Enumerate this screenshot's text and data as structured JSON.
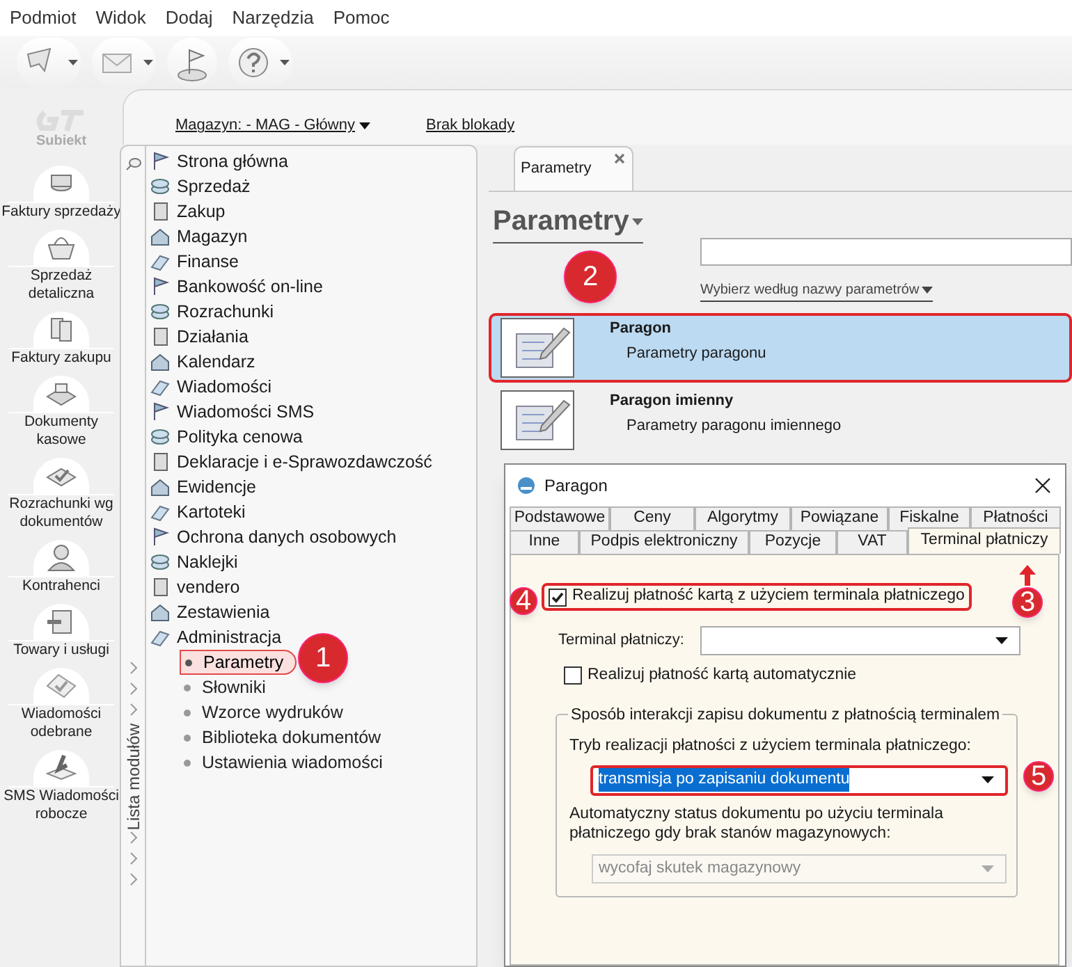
{
  "menu": [
    "Podmiot",
    "Widok",
    "Dodaj",
    "Narzędzia",
    "Pomoc"
  ],
  "app_logo": {
    "label": "Subiekt"
  },
  "nav": [
    {
      "label": "Faktury sprzedaży"
    },
    {
      "label": "Sprzedaż detaliczna"
    },
    {
      "label": "Faktury zakupu"
    },
    {
      "label": "Dokumenty kasowe"
    },
    {
      "label": "Rozrachunki wg dokumentów"
    },
    {
      "label": "Kontrahenci"
    },
    {
      "label": "Towary i usługi"
    },
    {
      "label": "Wiadomości odebrane"
    },
    {
      "label": "SMS Wiadomości robocze"
    }
  ],
  "top_bar": {
    "warehouse": "Magazyn: - MAG - Główny",
    "lock": "Brak blokady"
  },
  "module_list": {
    "title": "Lista modułów",
    "items": [
      {
        "label": "Strona główna",
        "selected": false
      },
      {
        "label": "Sprzedaż",
        "selected": false
      },
      {
        "label": "Zakup",
        "selected": false
      },
      {
        "label": "Magazyn",
        "selected": false
      },
      {
        "label": "Finanse",
        "selected": false
      },
      {
        "label": "Bankowość on-line",
        "selected": false
      },
      {
        "label": "Rozrachunki",
        "selected": false
      },
      {
        "label": "Działania",
        "selected": false
      },
      {
        "label": "Kalendarz",
        "selected": false
      },
      {
        "label": "Wiadomości",
        "selected": false
      },
      {
        "label": "Wiadomości SMS",
        "selected": false
      },
      {
        "label": "Polityka cenowa",
        "selected": false
      },
      {
        "label": "Deklaracje i e-Sprawozdawczość",
        "selected": false
      },
      {
        "label": "Ewidencje",
        "selected": false
      },
      {
        "label": "Kartoteki",
        "selected": false
      },
      {
        "label": "Ochrona danych osobowych",
        "selected": false
      },
      {
        "label": "Naklejki",
        "selected": false
      },
      {
        "label": "vendero",
        "selected": false
      },
      {
        "label": "Zestawienia",
        "selected": false
      },
      {
        "label": "Administracja",
        "selected": false,
        "children": [
          {
            "label": "Parametry",
            "selected": true,
            "highlighted": true
          },
          {
            "label": "Słowniki",
            "selected": false,
            "highlighted": false
          },
          {
            "label": "Wzorce wydruków",
            "selected": false,
            "highlighted": false
          },
          {
            "label": "Biblioteka dokumentów",
            "selected": false,
            "highlighted": false
          },
          {
            "label": "Ustawienia wiadomości",
            "selected": false,
            "highlighted": false
          }
        ]
      }
    ]
  },
  "tab": {
    "label": "Parametry"
  },
  "page_title": "Parametry",
  "filter_link": "Wybierz według nazwy parametrów",
  "params": [
    {
      "title": "Paragon",
      "subtitle": "Parametry paragonu",
      "selected": true,
      "highlighted": true
    },
    {
      "title": "Paragon imienny",
      "subtitle": "Parametry paragonu imiennego",
      "selected": false,
      "highlighted": false
    }
  ],
  "dialog": {
    "title": "Paragon",
    "tab_rows": [
      [
        {
          "label": "Podstawowe",
          "selected": false
        },
        {
          "label": "Ceny",
          "selected": false
        },
        {
          "label": "Algorytmy",
          "selected": false
        },
        {
          "label": "Powiązane",
          "selected": false
        },
        {
          "label": "Fiskalne",
          "selected": false
        },
        {
          "label": "Płatności",
          "selected": false
        }
      ],
      [
        {
          "label": "Inne",
          "selected": false
        },
        {
          "label": "Podpis elektroniczny",
          "selected": false
        },
        {
          "label": "Pozycje",
          "selected": false
        },
        {
          "label": "VAT",
          "selected": false
        },
        {
          "label": "Terminal płatniczy",
          "selected": true
        }
      ]
    ],
    "card_payment": {
      "label": "Realizuj płatność kartą z użyciem terminala płatniczego",
      "checked": true,
      "highlighted": true
    },
    "terminal": {
      "label": "Terminal płatniczy:"
    },
    "auto_payment": {
      "label": "Realizuj płatność kartą automatycznie",
      "checked": false,
      "highlighted": false
    },
    "group": {
      "title": "Sposób interakcji zapisu dokumentu z płatnością terminalem",
      "mode_label": "Tryb realizacji płatności z użyciem terminala płatniczego:",
      "mode": {
        "value": "transmisja po zapisaniu dokumentu",
        "highlighted": true
      },
      "status_label": "Automatyczny status dokumentu po użyciu terminala płatniczego gdy brak stanów magazynowych:",
      "status": {
        "value": "wycofaj skutek magazynowy",
        "disabled": true
      }
    }
  },
  "steps": [
    "1",
    "2",
    "3",
    "4",
    "5"
  ]
}
